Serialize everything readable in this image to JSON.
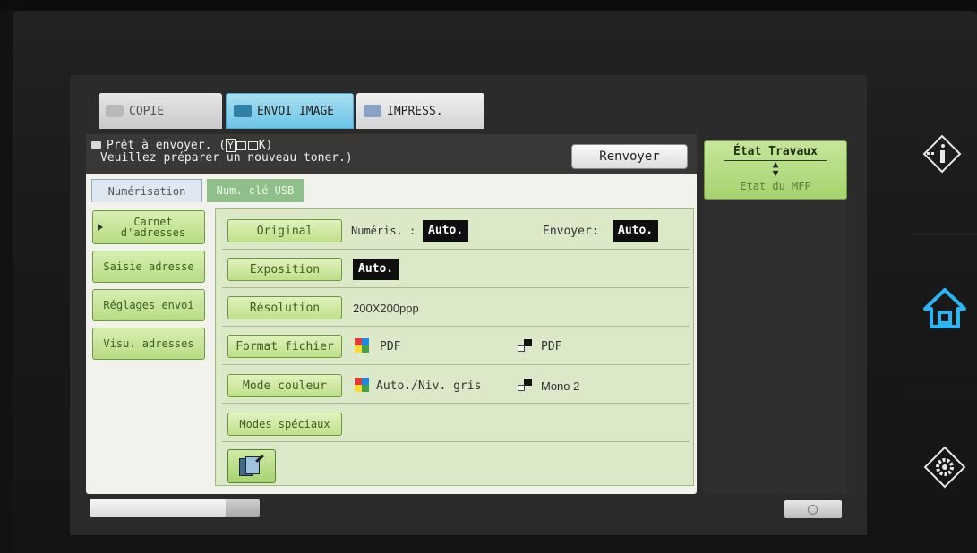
{
  "tabs": [
    {
      "label": "COPIE"
    },
    {
      "label": "ENVOI IMAGE"
    },
    {
      "label": "IMPRESS."
    }
  ],
  "status": {
    "line1_prefix": "Prêt à envoyer. (",
    "toner_code": "Y",
    "toner_tail": "K)",
    "line2": "Veuillez préparer un nouveau toner.)",
    "resend_label": "Renvoyer"
  },
  "subtabs": [
    {
      "label": "Numérisation"
    },
    {
      "label": "Num. clé USB"
    }
  ],
  "sidebar": {
    "items": [
      {
        "label": "Carnet d'adresses"
      },
      {
        "label": "Saisie adresse"
      },
      {
        "label": "Réglages envoi"
      },
      {
        "label": "Visu. adresses"
      }
    ]
  },
  "settings": {
    "original": {
      "label": "Original",
      "scan_label": "Numéris. :",
      "scan_value": "Auto.",
      "send_label": "Envoyer:",
      "send_value": "Auto."
    },
    "exposure": {
      "label": "Exposition",
      "value": "Auto."
    },
    "resolution": {
      "label": "Résolution",
      "value": "200X200ppp"
    },
    "file_format": {
      "label": "Format fichier",
      "color_value": "PDF",
      "mono_value": "PDF"
    },
    "color_mode": {
      "label": "Mode couleur",
      "color_value": "Auto./Niv. gris",
      "mono_value": "Mono 2"
    },
    "special_modes": {
      "label": "Modes spéciaux"
    }
  },
  "job_status": {
    "title": "État Travaux",
    "subtitle": "Etat du MFP"
  },
  "progress": {
    "fraction": 0.8
  },
  "icons": {
    "envelope": "envelope-icon",
    "preview": "scan-preview-icon",
    "info": "info-icon",
    "home": "home-icon",
    "settings": "gear-icon"
  },
  "colors": {
    "accent_green": "#b8dc84",
    "envoi_blue": "#6cc4e6",
    "home_glow": "#29b6f6"
  }
}
